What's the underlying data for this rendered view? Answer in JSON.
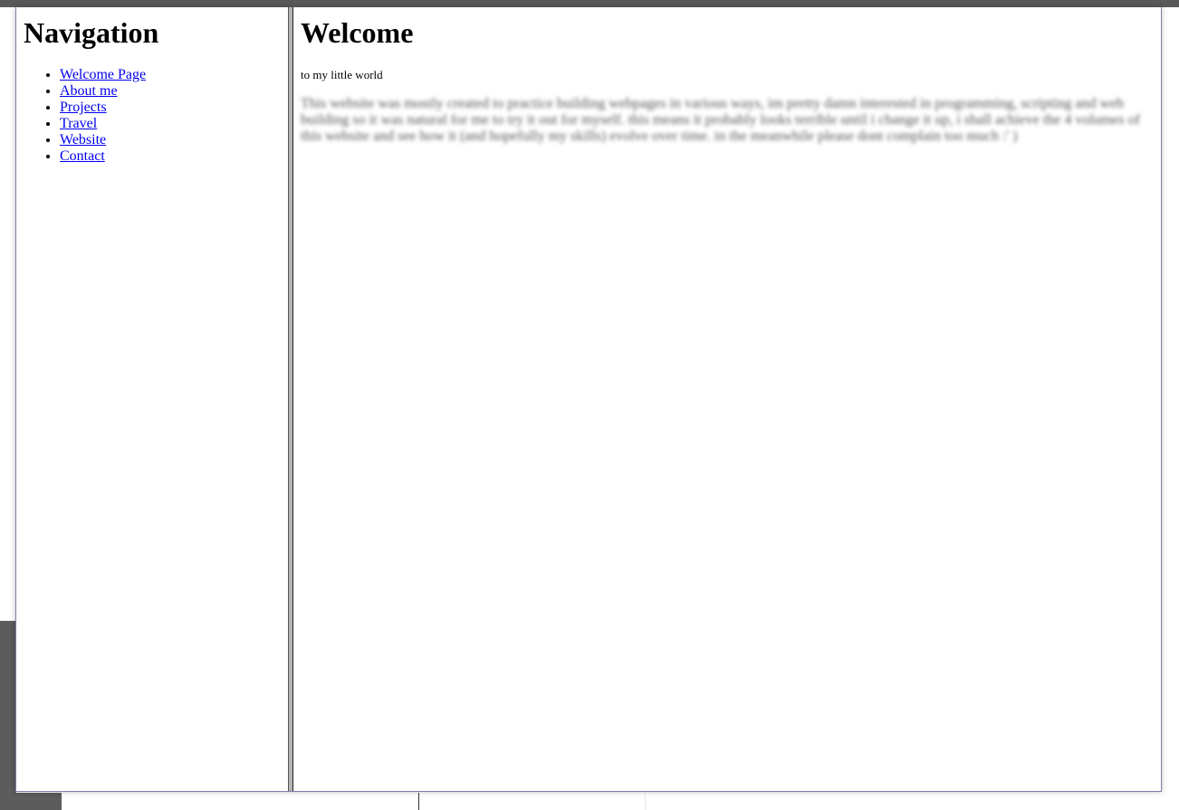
{
  "navigation": {
    "title": "Navigation",
    "items": [
      {
        "label": "Welcome Page"
      },
      {
        "label": "About me"
      },
      {
        "label": "Projects"
      },
      {
        "label": "Travel"
      },
      {
        "label": "Website"
      },
      {
        "label": "Contact"
      }
    ]
  },
  "main": {
    "title": "Welcome",
    "subtitle": "to my little world",
    "intro": "This website was mostly created to practice building webpages in various ways, im pretty damn interested in programming, scripting and web building so it was natural for me to try it out for myself. this means it probably looks terrible until i change it up, i shall achieve the 4 volumes of this website and see how it (and hopefully my skills) evolve over time. in the meanwhile please dont complain too much :' )"
  },
  "colors": {
    "link": "#0000ee",
    "divider": "#b4b4b4",
    "backdrop": "#595959"
  }
}
